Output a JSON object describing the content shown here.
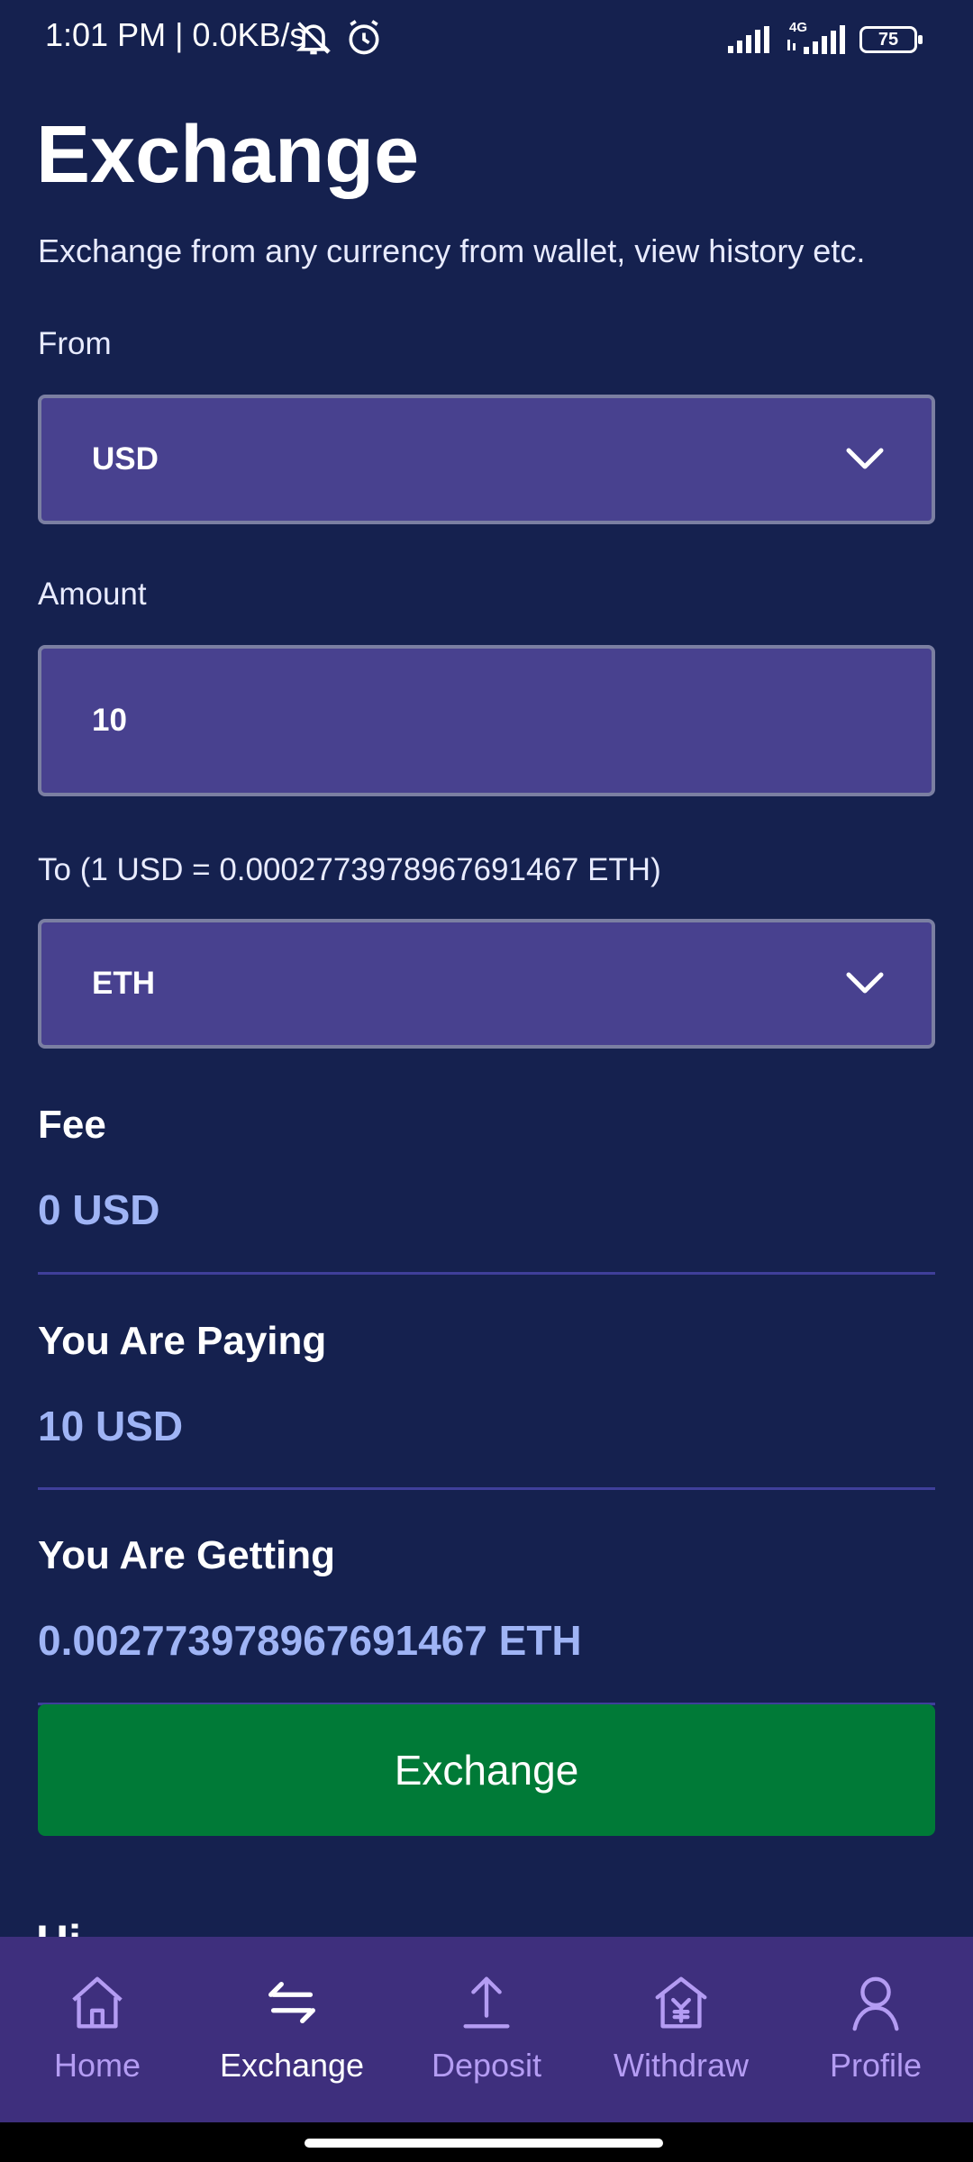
{
  "status_bar": {
    "time_speed": "1:01 PM | 0.0KB/s",
    "network": "4G",
    "battery": "75"
  },
  "header": {
    "title": "Exchange",
    "subtitle": "Exchange from any currency from wallet, view history etc."
  },
  "form": {
    "from_label": "From",
    "from_value": "USD",
    "amount_label": "Amount",
    "amount_value": "10",
    "to_label": "To (1 USD = 0.0002773978967691467 ETH)",
    "to_value": "ETH"
  },
  "summary": {
    "fee_label": "Fee",
    "fee_value": "0 USD",
    "paying_label": "You Are Paying",
    "paying_value": "10 USD",
    "getting_label": "You Are Getting",
    "getting_value": "0.002773978967691467 ETH"
  },
  "actions": {
    "exchange_label": "Exchange"
  },
  "history_peek": "Hi",
  "bottom_nav": {
    "active": "Exchange",
    "items": [
      {
        "label": "Home",
        "icon": "home-icon"
      },
      {
        "label": "Exchange",
        "icon": "exchange-arrows-icon"
      },
      {
        "label": "Deposit",
        "icon": "upload-icon"
      },
      {
        "label": "Withdraw",
        "icon": "bank-yen-icon"
      },
      {
        "label": "Profile",
        "icon": "person-icon"
      }
    ]
  },
  "colors": {
    "background": "#15214f",
    "field": "#48418f",
    "accent_value": "#9fb4f5",
    "button": "#007a37",
    "nav_background": "#3e2f7d",
    "nav_inactive": "#b49cf3"
  }
}
